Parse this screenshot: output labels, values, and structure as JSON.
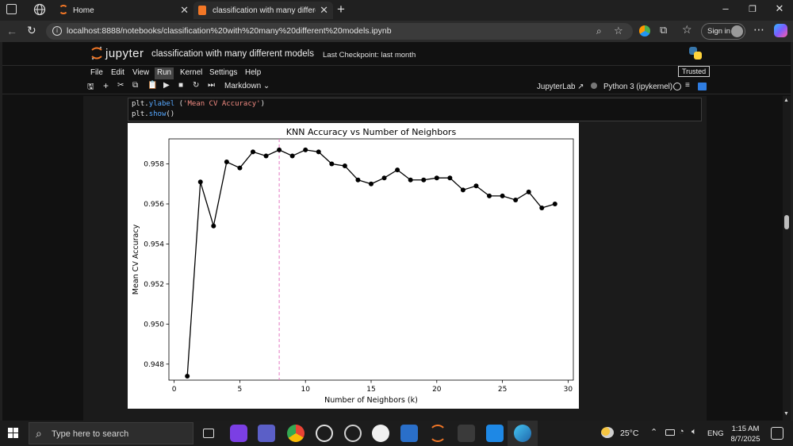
{
  "browser": {
    "tabs": [
      {
        "title": "Home",
        "active": false
      },
      {
        "title": "classification with many different",
        "active": true
      }
    ],
    "url": "localhost:8888/notebooks/classification%20with%20many%20different%20models.ipynb",
    "signin_label": "Sign in"
  },
  "jupyter": {
    "brand": "jupyter",
    "notebook_title": "classification with many different models",
    "checkpoint": "Last Checkpoint: last month",
    "trusted": "Trusted",
    "menus": [
      "File",
      "Edit",
      "View",
      "Run",
      "Kernel",
      "Settings",
      "Help"
    ],
    "active_menu": "Run",
    "cell_type": "Markdown",
    "jupyterlab_label": "JupyterLab",
    "kernel": "Python 3 (ipykernel)",
    "code_line1_a": "plt.",
    "code_line1_b": "ylabel",
    "code_line1_c": " (",
    "code_line1_d": "'Mean CV Accuracy'",
    "code_line1_e": ")",
    "code_line2_a": "plt.",
    "code_line2_b": "show",
    "code_line2_c": "()"
  },
  "chart_data": {
    "type": "line",
    "title": "KNN Accuracy vs Number of Neighbors",
    "xlabel": "Number of Neighbors (k)",
    "ylabel": "Mean CV Accuracy",
    "xlim": [
      -0.4,
      30.4
    ],
    "ylim": [
      0.9472,
      0.95925
    ],
    "xticks": [
      0,
      5,
      10,
      15,
      20,
      25,
      30
    ],
    "yticks": [
      0.948,
      0.95,
      0.952,
      0.954,
      0.956,
      0.958
    ],
    "ytick_labels": [
      "0.948",
      "0.950",
      "0.952",
      "0.954",
      "0.956",
      "0.958"
    ],
    "x": [
      1,
      2,
      3,
      4,
      5,
      6,
      7,
      8,
      9,
      10,
      11,
      12,
      13,
      14,
      15,
      16,
      17,
      18,
      19,
      20,
      21,
      22,
      23,
      24,
      25,
      26,
      27,
      28,
      29
    ],
    "y": [
      0.9474,
      0.9571,
      0.9549,
      0.9581,
      0.9578,
      0.9586,
      0.9584,
      0.9587,
      0.9584,
      0.9587,
      0.9586,
      0.958,
      0.9579,
      0.9572,
      0.957,
      0.9573,
      0.9577,
      0.9572,
      0.9572,
      0.9573,
      0.9573,
      0.9567,
      0.9569,
      0.9564,
      0.9564,
      0.9562,
      0.9566,
      0.9558,
      0.956
    ],
    "vline": {
      "x": 8,
      "color": "#e377c2",
      "style": "dashed"
    },
    "line_color": "#000000",
    "grid": false
  },
  "taskbar": {
    "search_placeholder": "Type here to search",
    "temperature": "25°C",
    "language": "ENG",
    "time": "1:15 AM",
    "date": "8/7/2025"
  }
}
